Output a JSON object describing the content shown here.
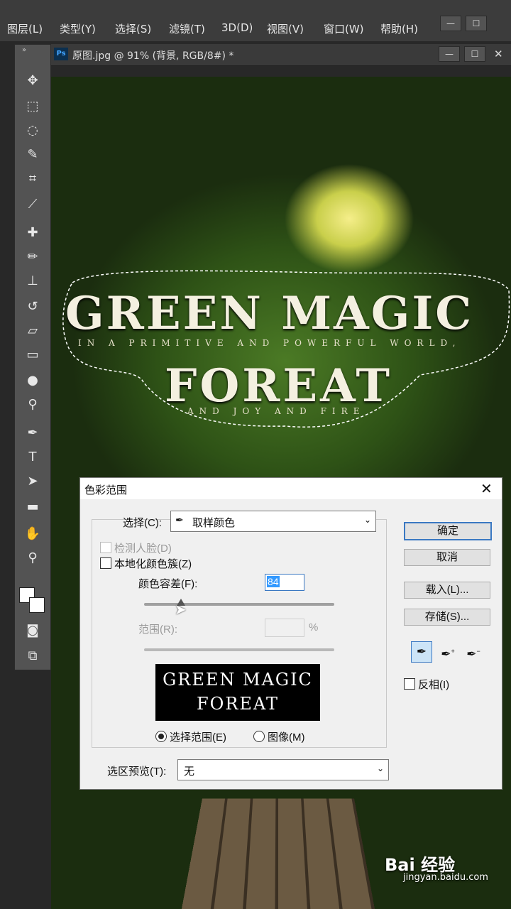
{
  "menu": [
    "图层(L)",
    "类型(Y)",
    "选择(S)",
    "滤镜(T)",
    "3D(D)",
    "视图(V)",
    "窗口(W)",
    "帮助(H)"
  ],
  "window_controls": {
    "minimize": "—",
    "maximize": "☐",
    "close": "✕"
  },
  "document_tab": {
    "ps_badge": "Ps",
    "title": "原图.jpg @ 91% (背景, RGB/8#) *"
  },
  "artwork": {
    "title_line1": "GREEN MAGIC",
    "subtitle_line1": "IN A PRIMITIVE AND POWERFUL WORLD,",
    "title_line2": "FOREAT",
    "subtitle_line2": "AND JOY AND FIRE"
  },
  "dialog": {
    "title": "色彩范围",
    "select_label": "选择(C):",
    "select_value": "取样颜色",
    "detect_faces": "检测人脸(D)",
    "localized_clusters": "本地化颜色簇(Z)",
    "fuzziness_label": "颜色容差(F):",
    "fuzziness_value": "84",
    "range_label": "范围(R):",
    "range_unit": "%",
    "preview_line1": "GREEN MAGIC",
    "preview_line2": "FOREAT",
    "radio_selection": "选择范围(E)",
    "radio_image": "图像(M)",
    "selection_preview_label": "选区预览(T):",
    "selection_preview_value": "无",
    "ok": "确定",
    "cancel": "取消",
    "load": "载入(L)...",
    "save": "存储(S)...",
    "invert": "反相(I)"
  },
  "watermark": {
    "brand": "Bai 经验",
    "url": "jingyan.baidu.com"
  }
}
